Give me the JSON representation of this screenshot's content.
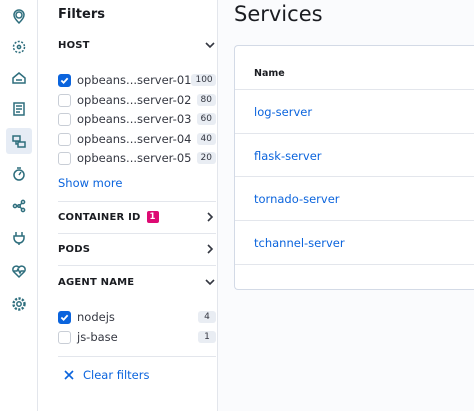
{
  "nav": {
    "icons": [
      "map-pin-icon",
      "graph-icon",
      "logs-icon",
      "notebook-icon",
      "apm-icon",
      "uptime-icon",
      "nodes-icon",
      "plug-icon",
      "heartbeat-icon",
      "gear-icon"
    ],
    "active_icon": "apm-icon"
  },
  "filters": {
    "title": "Filters",
    "host": {
      "label": "HOST",
      "options": [
        {
          "label": "opbeans...server-01",
          "count": "100",
          "checked": true
        },
        {
          "label": "opbeans...server-02",
          "count": "80",
          "checked": false
        },
        {
          "label": "opbeans...server-03",
          "count": "60",
          "checked": false
        },
        {
          "label": "opbeans...server-04",
          "count": "40",
          "checked": false
        },
        {
          "label": "opbeans...server-05",
          "count": "20",
          "checked": false
        }
      ],
      "show_more": "Show more"
    },
    "container_id": {
      "label": "CONTAINER ID",
      "badge": "1"
    },
    "pods": {
      "label": "PODS"
    },
    "agent_name": {
      "label": "AGENT NAME",
      "options": [
        {
          "label": "nodejs",
          "count": "4",
          "checked": true
        },
        {
          "label": "js-base",
          "count": "1",
          "checked": false
        }
      ]
    },
    "clear_label": "Clear filters"
  },
  "main": {
    "title": "Services",
    "table": {
      "column": "Name",
      "rows": [
        "log-server",
        "flask-server",
        "tornado-server",
        "tchannel-server"
      ]
    }
  },
  "colors": {
    "accent": "#0b64dd",
    "badge": "#dd0a73",
    "nav_icon": "#2e6e7d"
  }
}
